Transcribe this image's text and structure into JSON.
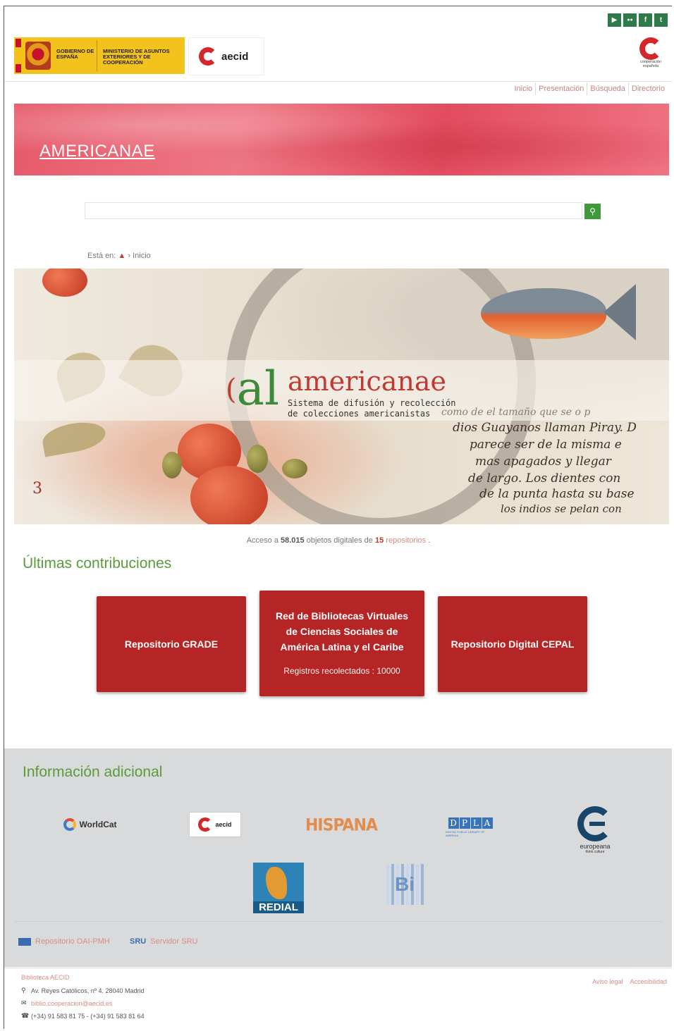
{
  "social": [
    {
      "icon": "youtube-icon",
      "glyph": "▶"
    },
    {
      "icon": "flickr-icon",
      "glyph": "●●"
    },
    {
      "icon": "facebook-icon",
      "glyph": "f"
    },
    {
      "icon": "twitter-icon",
      "glyph": "t"
    }
  ],
  "header": {
    "gov_line1": "GOBIERNO DE ESPAÑA",
    "gov_line2": "MINISTERIO DE ASUNTOS EXTERIORES Y DE COOPERACIÓN",
    "aecid": "aecid",
    "coop_label": "cooperación española"
  },
  "nav": [
    "Inicio",
    "Presentación",
    "Búsqueda",
    "Directorio"
  ],
  "banner": {
    "title": "AMERICANAE"
  },
  "search": {
    "value": "",
    "button_icon": "search-icon"
  },
  "breadcrumb": {
    "prefix": "Está en:",
    "current": "› Inicio"
  },
  "hero": {
    "brand": "americanae",
    "tagline1": "Sistema de difusión y recolección",
    "tagline2": "de colecciones americanistas",
    "script_lines": [
      "como de el tamaño que se o p",
      "dios Guayanos llaman Piray. D",
      "parece ser de la misma e",
      "mas apagados y llegar",
      "de largo. Los dientes con",
      "de la punta hasta su base",
      "los indios se pelan con"
    ],
    "page_number": "3"
  },
  "stats": {
    "pre": "Acceso a",
    "objects": "58.015",
    "mid": "objetos digitales de",
    "repos": "15",
    "repos_label": "repositorios",
    "end": "."
  },
  "latest": {
    "heading": "Últimas contribuciones",
    "cards": [
      {
        "title": "Repositorio GRADE",
        "sub": ""
      },
      {
        "title": "Red de Bibliotecas Virtuales de Ciencias Sociales de América Latina y el Caribe",
        "sub": "Registros recolectados : 10000"
      },
      {
        "title": "Repositorio Digital CEPAL",
        "sub": ""
      }
    ]
  },
  "info": {
    "heading": "Información adicional",
    "partners": [
      "WorldCat",
      "aecid",
      "HISPANA",
      "DPLA",
      "europeana",
      "REDIAL",
      "Bi"
    ],
    "europeana_tag": "think culture",
    "dpla_small": "DIGITAL PUBLIC LIBRARY OF AMERICA",
    "oai_label": "Repositorio OAI-PMH",
    "sru_icon_text": "SRU",
    "sru_label": "Servidor SRU"
  },
  "footer": {
    "title": "Biblioteca AECID",
    "address": "Av. Reyes Católicos, nº 4. 28040 Madrid",
    "email": "biblio.cooperacion@aecid.es",
    "phone": "(+34) 91 583 81 75 - (+34) 91 583 81 64",
    "links": [
      "Aviso legal",
      "Accesibilidad"
    ]
  },
  "colors": {
    "brand_red": "#b52525",
    "green": "#5a9b3a",
    "link_pink": "#d78d86"
  }
}
